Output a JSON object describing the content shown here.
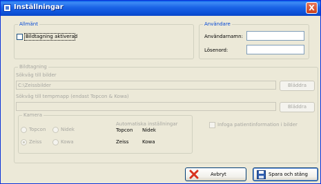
{
  "window": {
    "title": "Inställningar",
    "close_label": "X"
  },
  "allmant": {
    "legend": "Allmänt",
    "checkbox_label": "Bildtagning aktiverad",
    "checked": false
  },
  "anvandare": {
    "legend": "Användare",
    "username_label": "Användarnamn:",
    "username_value": "",
    "password_label": "Lösenord:",
    "password_value": ""
  },
  "bildtagning": {
    "legend": "Bildtagning",
    "images_path_label": "Sökväg till bilder",
    "images_path_value": "C:\\Zeissbilder",
    "browse_label_1": "Bläddra",
    "temp_path_label": "Sökväg till tempmapp (endast Topcon & Kowa)",
    "temp_path_value": "",
    "browse_label_2": "Bläddra",
    "patient_info_label": "Infoga patientinformation i bilder"
  },
  "kamera": {
    "legend": "Kamera",
    "options": [
      "Topcon",
      "Nidek",
      "Zeiss",
      "Kowa"
    ],
    "selected": "Zeiss",
    "auto_settings_label": "Automatiska inställningar",
    "auto_row1": [
      "Topcon",
      "Nidek"
    ],
    "auto_row2": [
      "Zeiss",
      "Kowa"
    ]
  },
  "buttons": {
    "cancel": "Avbryt",
    "save": "Spara och stäng"
  },
  "colors": {
    "title_bar": "#0a5ee8",
    "legend_blue": "#0046d5",
    "cancel_icon": "#d8321e",
    "save_icon": "#2f5fb0"
  }
}
